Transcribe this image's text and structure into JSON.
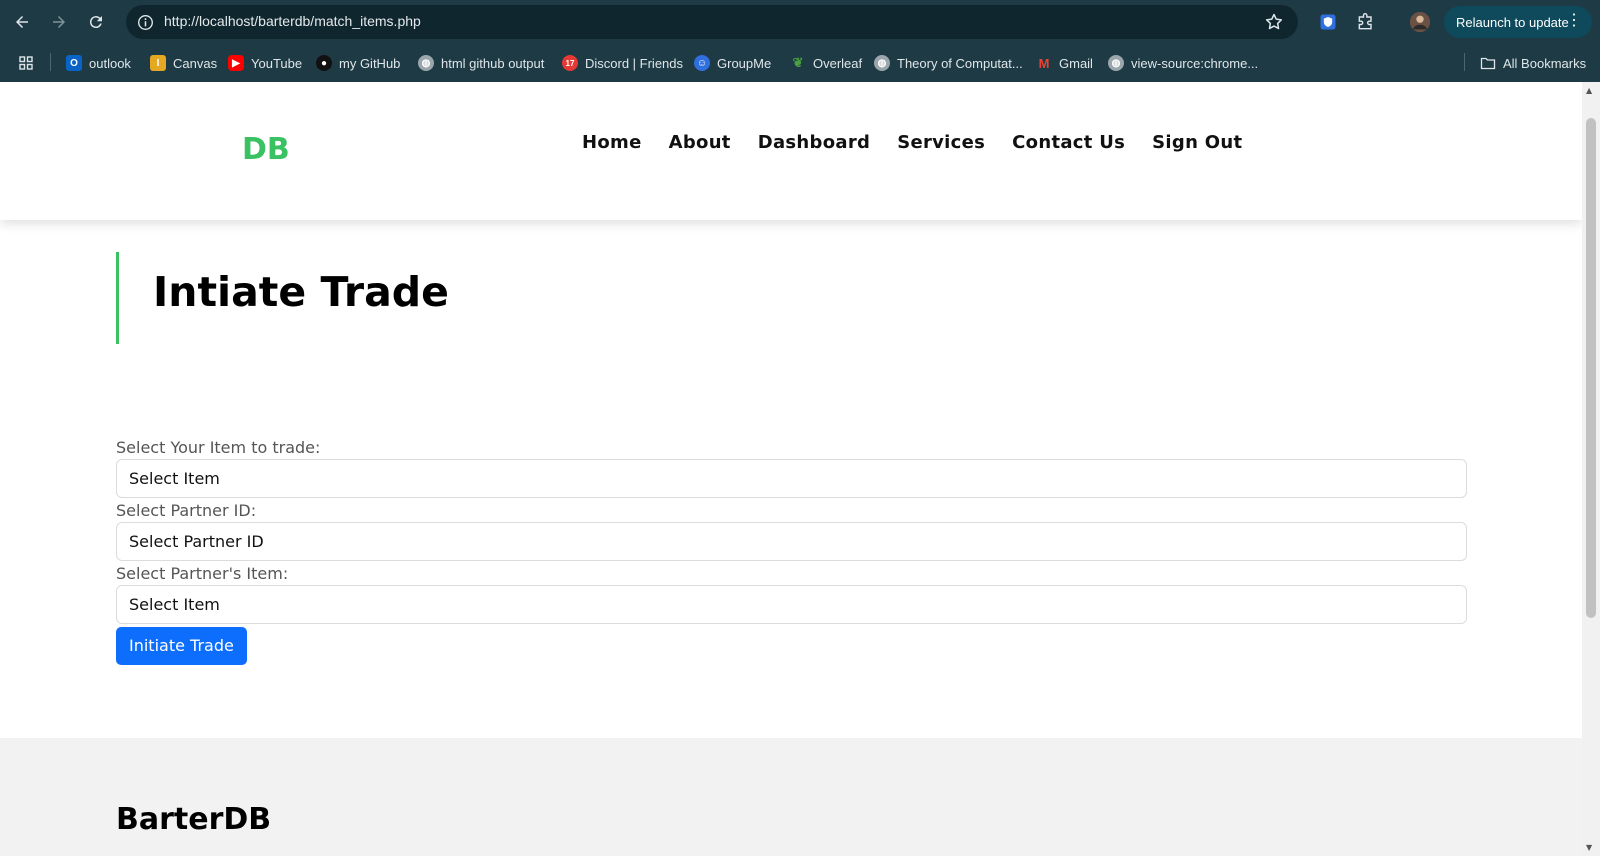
{
  "browser": {
    "url": "http://localhost/barterdb/match_items.php",
    "relaunch_label": "Relaunch to update",
    "bookmarks": [
      {
        "label": "outlook",
        "icon": "outlook-icon",
        "color": "#0a64c8"
      },
      {
        "label": "Canvas",
        "icon": "canvas-icon",
        "color": "#e5a823"
      },
      {
        "label": "YouTube",
        "icon": "youtube-icon",
        "color": "#ff0000"
      },
      {
        "label": "my GitHub",
        "icon": "github-icon",
        "color": "#111111"
      },
      {
        "label": "html github output",
        "icon": "globe-icon",
        "color": "#9aa6ab"
      },
      {
        "label": "Discord | Friends",
        "icon": "discord-icon",
        "color": "#e53935"
      },
      {
        "label": "GroupMe",
        "icon": "groupme-icon",
        "color": "#2f6fe0"
      },
      {
        "label": "Overleaf",
        "icon": "overleaf-icon",
        "color": "#47a141"
      },
      {
        "label": "Theory of Computat...",
        "icon": "globe-icon",
        "color": "#9aa6ab"
      },
      {
        "label": "Gmail",
        "icon": "gmail-icon",
        "color": "#ea4335"
      },
      {
        "label": "view-source:chrome...",
        "icon": "globe-icon",
        "color": "#9aa6ab"
      }
    ],
    "all_bookmarks_label": "All Bookmarks",
    "discord_badge": "17"
  },
  "site": {
    "logo": "DB",
    "nav": [
      "Home",
      "About",
      "Dashboard",
      "Services",
      "Contact Us",
      "Sign Out"
    ],
    "accent_color": "#3ac162"
  },
  "main": {
    "title": "Intiate Trade",
    "form": {
      "your_item_label": "Select Your Item to trade:",
      "your_item_value": "Select Item",
      "partner_id_label": "Select Partner ID:",
      "partner_id_value": "Select Partner ID",
      "partner_item_label": "Select Partner's Item:",
      "partner_item_value": "Select Item",
      "submit_label": "Initiate Trade"
    }
  },
  "footer": {
    "title": "BarterDB"
  }
}
